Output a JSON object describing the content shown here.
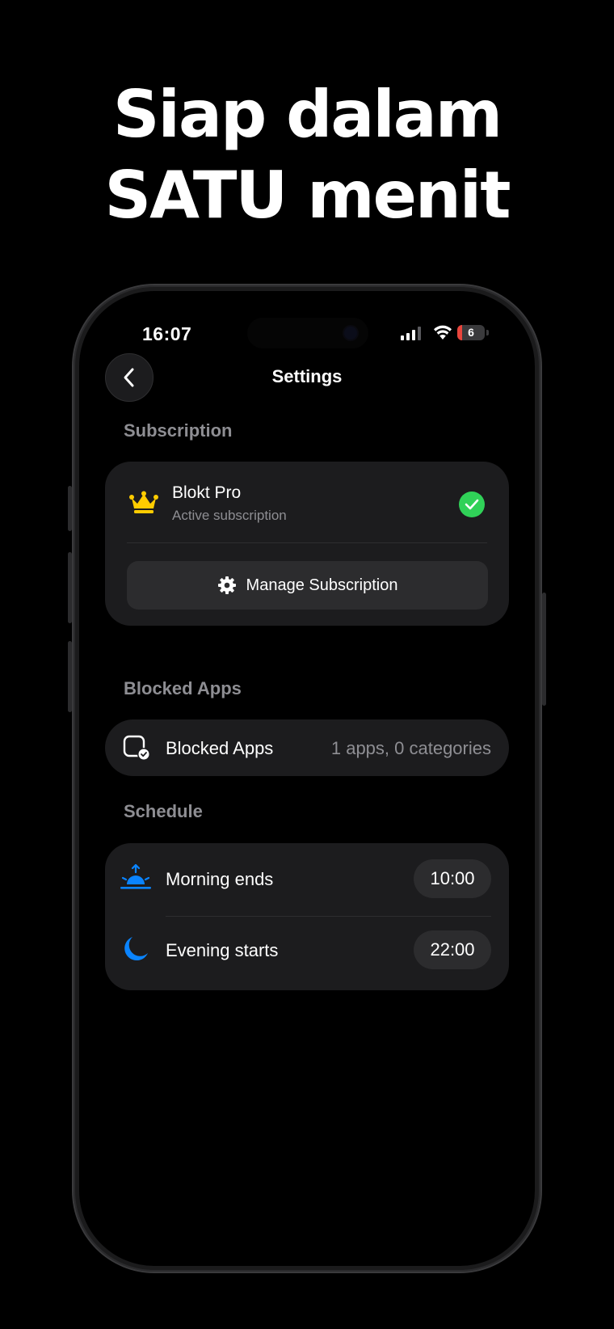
{
  "headline": {
    "line1": "Siap dalam",
    "line2": "SATU menit"
  },
  "status_bar": {
    "time": "16:07",
    "battery": "6",
    "icons": [
      "signal-icon",
      "wifi-icon",
      "battery-icon"
    ]
  },
  "nav": {
    "title": "Settings",
    "back_icon": "chevron-left-icon"
  },
  "subscription": {
    "section_title": "Subscription",
    "plan_name": "Blokt Pro",
    "plan_status": "Active subscription",
    "manage_label": "Manage Subscription",
    "icons": [
      "crown-icon",
      "check-circle-icon",
      "gear-icon"
    ]
  },
  "blocked_apps": {
    "section_title": "Blocked Apps",
    "row_label": "Blocked Apps",
    "row_value": "1 apps, 0 categories",
    "icon": "app-shield-icon"
  },
  "schedule": {
    "section_title": "Schedule",
    "rows": [
      {
        "label": "Morning ends",
        "time": "10:00",
        "icon": "sunrise-icon"
      },
      {
        "label": "Evening starts",
        "time": "22:00",
        "icon": "moon-icon"
      }
    ]
  },
  "colors": {
    "background": "#000000",
    "card": "#1c1c1e",
    "secondary_text": "#8e8e93",
    "accent_green": "#30d158",
    "accent_blue": "#0a84ff",
    "crown_yellow": "#ffcc00"
  }
}
